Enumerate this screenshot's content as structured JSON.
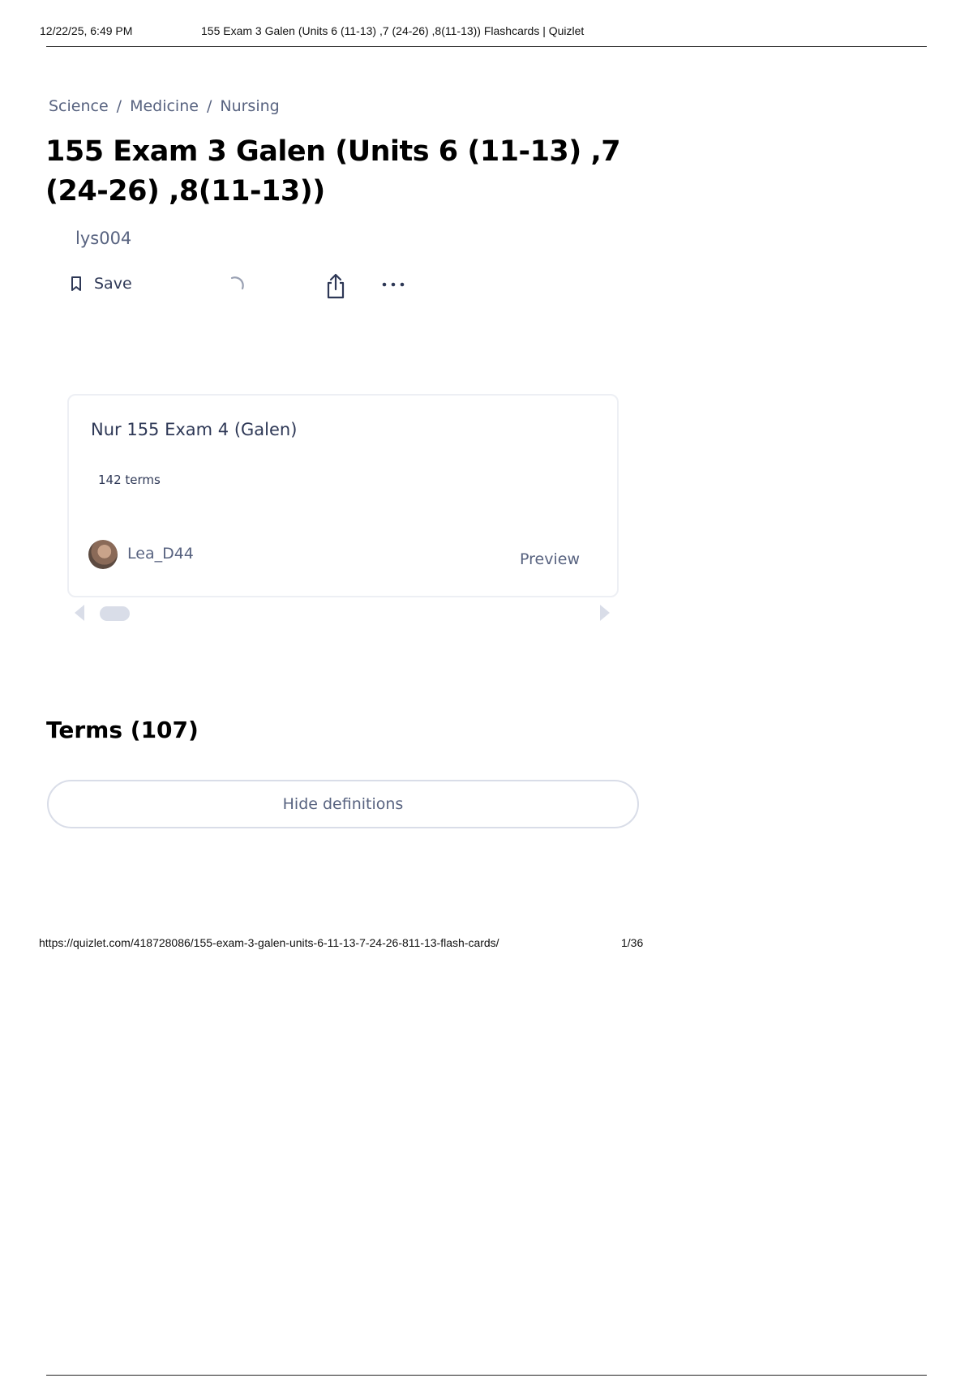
{
  "print_header": {
    "date": "12/22/25, 6:49 PM",
    "title": "155 Exam 3 Galen (Units 6 (11-13) ,7 (24-26) ,8(11-13)) Flashcards | Quizlet"
  },
  "breadcrumb": [
    "Science",
    "Medicine",
    "Nursing"
  ],
  "breadcrumb_separator": "/",
  "set": {
    "title": "155 Exam 3 Galen (Units 6 (11-13) ,7 (24-26) ,8(11-13))",
    "author": "lys004"
  },
  "toolbar": {
    "save_label": "Save",
    "icons": [
      "bookmark-icon",
      "loading-spinner-icon",
      "share-icon",
      "more-options-icon"
    ]
  },
  "related_set": {
    "title": "Nur 155 Exam 4 (Galen)",
    "terms": "142 terms",
    "user": "Lea_D44",
    "preview_label": "Preview"
  },
  "terms_section": {
    "heading": "Terms (107)",
    "toggle_label": "Hide definitions"
  },
  "print_footer": {
    "url": "https://quizlet.com/418728086/155-exam-3-galen-units-6-11-13-7-24-26-811-13-flash-cards/",
    "page": "1/36"
  },
  "colors": {
    "muted_text": "#586380",
    "dark_text": "#2e3856",
    "border": "#d9dde8"
  }
}
